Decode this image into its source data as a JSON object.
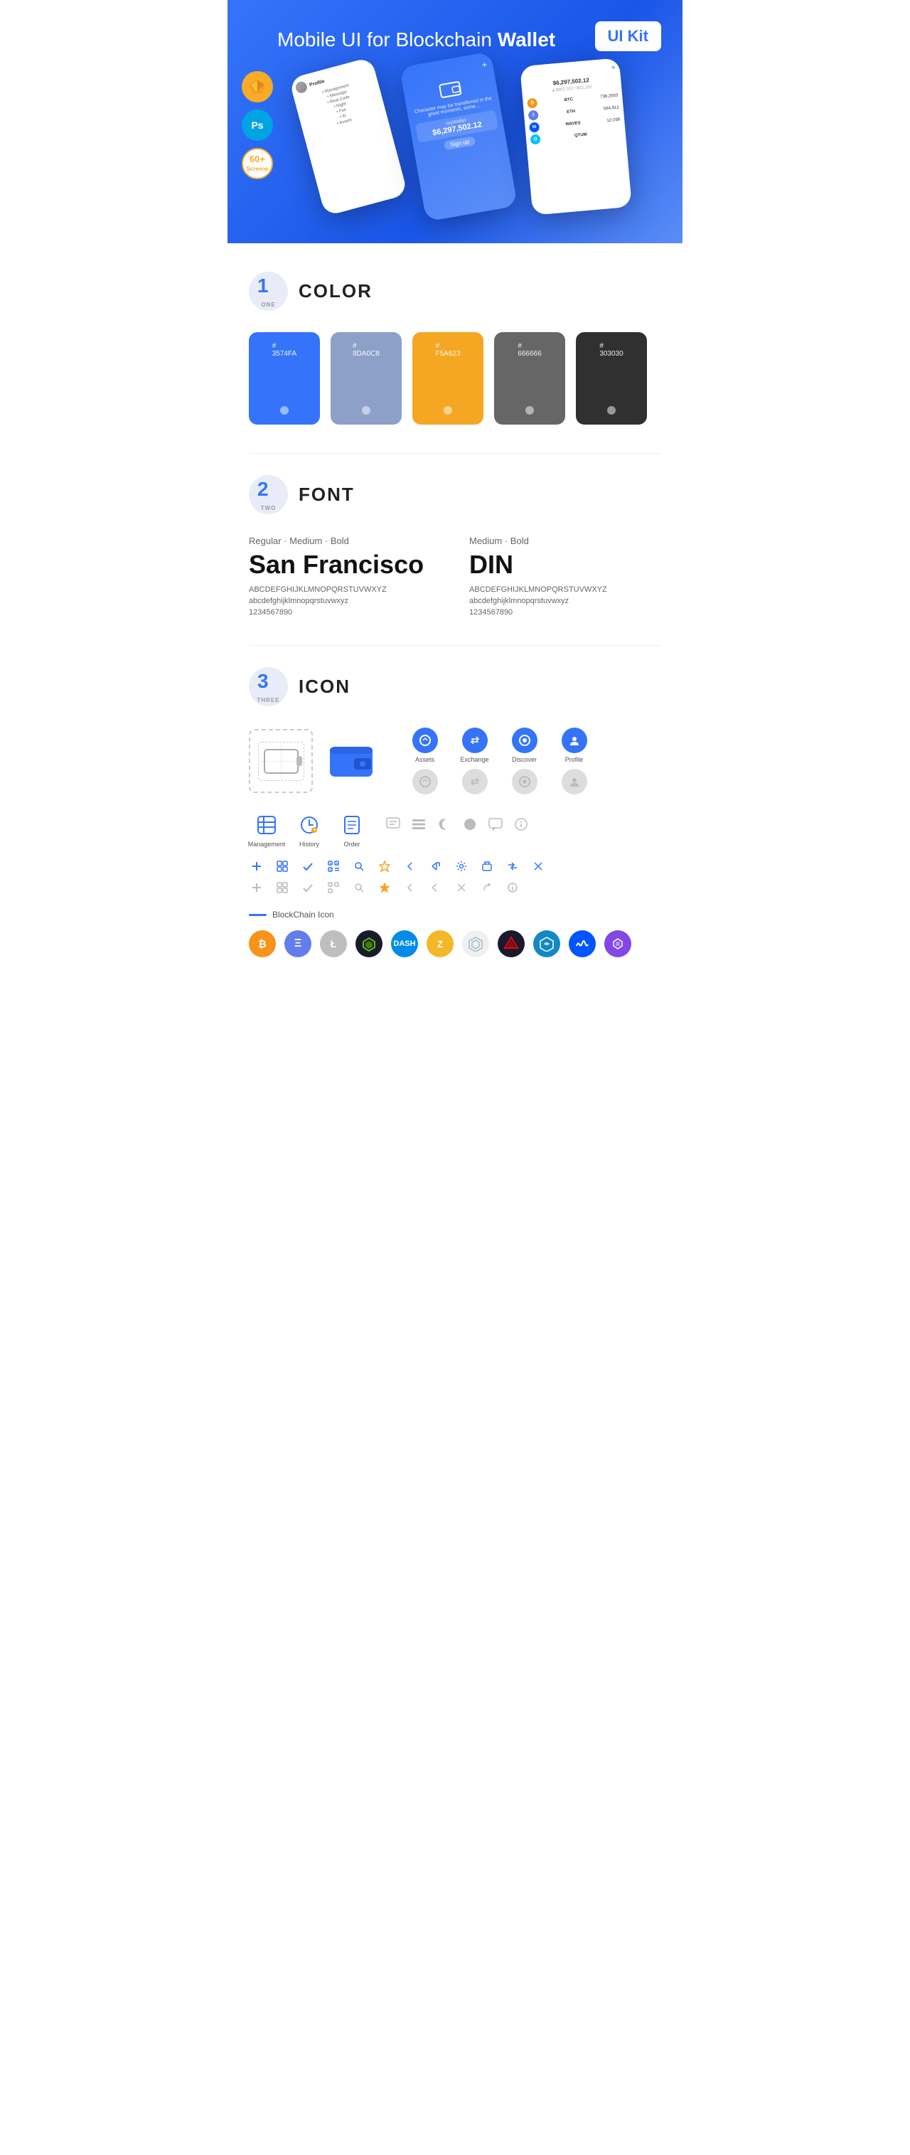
{
  "hero": {
    "title": "Mobile UI for Blockchain ",
    "title_bold": "Wallet",
    "badge": "UI Kit",
    "tools": [
      {
        "label": "Sk",
        "type": "sketch"
      },
      {
        "label": "Ps",
        "type": "ps"
      },
      {
        "label": "60+\nScreens",
        "type": "screens"
      }
    ]
  },
  "sections": {
    "color": {
      "number": "1",
      "number_label": "ONE",
      "title": "COLOR",
      "swatches": [
        {
          "hex": "#3574FA",
          "label": "3574FA"
        },
        {
          "hex": "#8DA0C8",
          "label": "8DA0C8"
        },
        {
          "hex": "#F5A623",
          "label": "F5A623"
        },
        {
          "hex": "#666666",
          "label": "666666"
        },
        {
          "hex": "#303030",
          "label": "303030"
        }
      ]
    },
    "font": {
      "number": "2",
      "number_label": "TWO",
      "title": "FONT",
      "fonts": [
        {
          "style": "Regular · Medium · Bold",
          "name": "San Francisco",
          "uppercase": "ABCDEFGHIJKLMNOPQRSTUVWXYZ",
          "lowercase": "abcdefghijklmnopqrstuvwxyz",
          "numbers": "1234567890"
        },
        {
          "style": "Medium · Bold",
          "name": "DIN",
          "uppercase": "ABCDEFGHIJKLMNOPQRSTUVWXYZ",
          "lowercase": "abcdefghijklmnopqrstuvwxyz",
          "numbers": "1234567890"
        }
      ]
    },
    "icon": {
      "number": "3",
      "number_label": "THREE",
      "title": "ICON",
      "nav_icons": [
        {
          "label": "Assets",
          "color": "blue"
        },
        {
          "label": "Exchange",
          "color": "blue"
        },
        {
          "label": "Discover",
          "color": "blue"
        },
        {
          "label": "Profile",
          "color": "blue"
        }
      ],
      "nav_icons_gray": [
        {
          "label": "",
          "color": "gray"
        },
        {
          "label": "",
          "color": "gray"
        },
        {
          "label": "",
          "color": "gray"
        },
        {
          "label": "",
          "color": "gray"
        }
      ],
      "tab_icons": [
        {
          "label": "Management",
          "symbol": "▣"
        },
        {
          "label": "History",
          "symbol": "⏱"
        },
        {
          "label": "Order",
          "symbol": "📋"
        }
      ],
      "small_icons_blue": [
        "+",
        "⊞",
        "✓",
        "⊟",
        "⌕",
        "☆",
        "❮",
        "⟨",
        "⚙",
        "⊡",
        "⇌",
        "✕"
      ],
      "small_icons_gray": [
        "+",
        "⊞",
        "✓",
        "⊟",
        "⌕",
        "☆",
        "❮",
        "⟨",
        "⚙",
        "⊡",
        "⇌",
        "✕"
      ],
      "blockchain_label": "BlockChain Icon",
      "crypto_icons": [
        {
          "symbol": "₿",
          "class": "crypto-btc",
          "label": "BTC"
        },
        {
          "symbol": "Ξ",
          "class": "crypto-eth",
          "label": "ETH"
        },
        {
          "symbol": "Ł",
          "class": "crypto-ltc",
          "label": "LTC"
        },
        {
          "symbol": "N",
          "class": "crypto-neo",
          "label": "NEO"
        },
        {
          "symbol": "D",
          "class": "crypto-dash",
          "label": "DASH"
        },
        {
          "symbol": "Z",
          "class": "crypto-zcash",
          "label": "ZEC"
        },
        {
          "symbol": "◈",
          "class": "crypto-iota",
          "label": "IOTA"
        },
        {
          "symbol": "▲",
          "class": "crypto-ark",
          "label": "ARK"
        },
        {
          "symbol": "◈",
          "class": "crypto-stratis",
          "label": "STRAT"
        },
        {
          "symbol": "W",
          "class": "crypto-waves",
          "label": "WAVES"
        },
        {
          "symbol": "M",
          "class": "crypto-matic",
          "label": "MATIC"
        }
      ]
    }
  }
}
